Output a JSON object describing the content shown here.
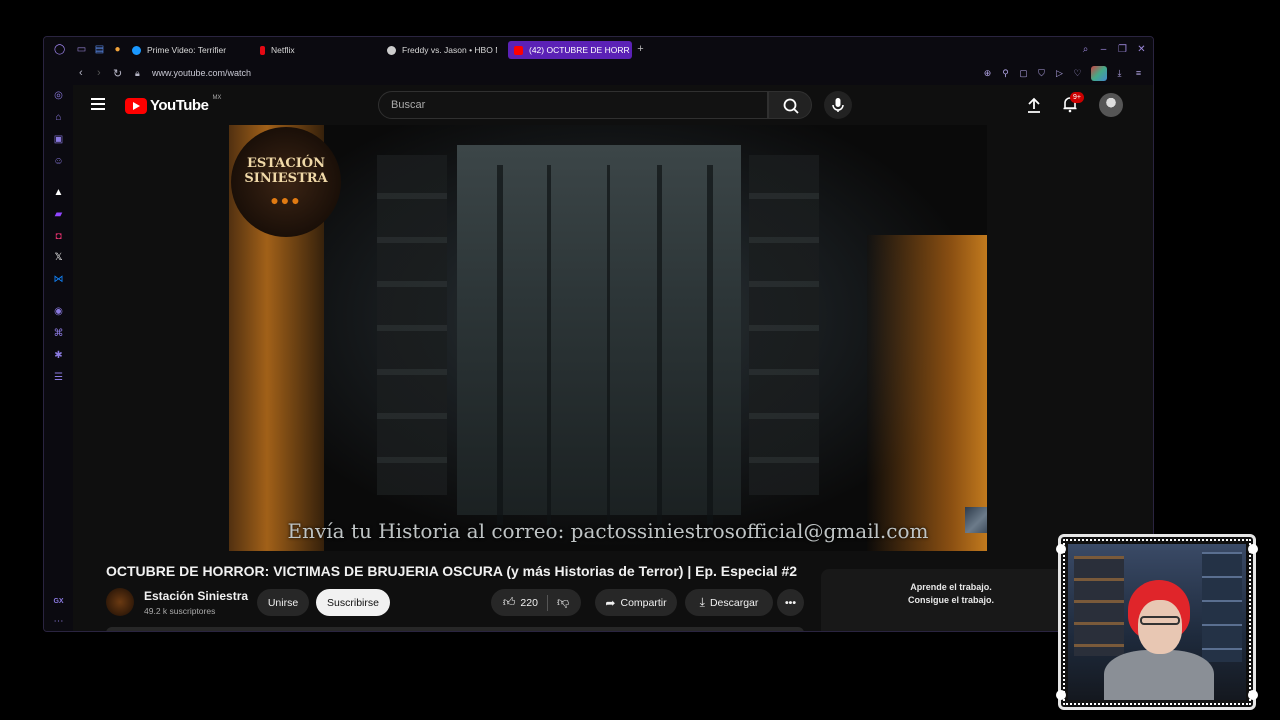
{
  "browser": {
    "tabs": [
      {
        "label": "Prime Video: Terrifier",
        "favicon_color": "#1a98ff"
      },
      {
        "label": "Netflix",
        "favicon_color": "#e50914"
      },
      {
        "label": "Freddy vs. Jason • HBO M",
        "favicon_color": "#cccccc"
      },
      {
        "label": "(42) OCTUBRE DE HORR",
        "favicon_color": "#ff0000"
      }
    ],
    "new_tab": "+",
    "url": "www.youtube.com/watch",
    "sidebar_label": "GX"
  },
  "youtube": {
    "logo_text": "YouTube",
    "country": "MX",
    "search_placeholder": "Buscar",
    "notification_count": "9+",
    "video": {
      "channel_badge_line1": "ESTACIÓN",
      "channel_badge_line2": "SINIESTRA",
      "caption": "Envía tu Historia al correo: pactossiniestrosofficial@gmail.com"
    },
    "title": "OCTUBRE DE HORROR: VICTIMAS DE BRUJERIA OSCURA (y más Historias de Terror) | Ep. Especial #2",
    "channel": {
      "name": "Estación Siniestra",
      "subscribers": "49.2 k suscriptores"
    },
    "actions": {
      "join": "Unirse",
      "subscribe": "Suscribirse",
      "likes": "220",
      "share": "Compartir",
      "download": "Descargar"
    },
    "ad": {
      "line1": "Aprende el trabajo.",
      "line2": "Consigue el trabajo."
    }
  },
  "colors": {
    "accent": "#5b21b6",
    "youtube_red": "#ff0000",
    "background": "#0f0f0f"
  }
}
